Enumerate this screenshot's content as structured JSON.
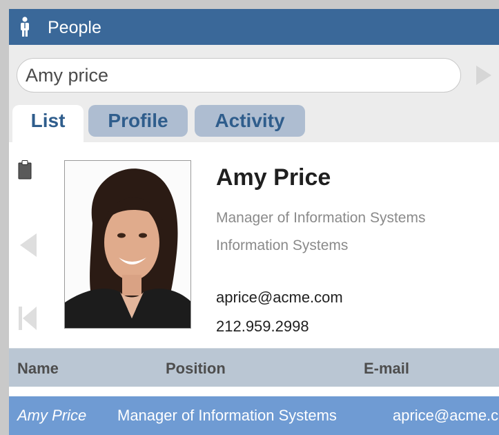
{
  "window": {
    "title": "People",
    "icon": "person-icon"
  },
  "search": {
    "value": "Amy price",
    "placeholder": "",
    "go_icon": "play-arrow-icon"
  },
  "tabs": [
    {
      "label": "List",
      "active": true
    },
    {
      "label": "Profile",
      "active": false
    },
    {
      "label": "Activity",
      "active": false
    }
  ],
  "profile": {
    "name": "Amy Price",
    "position": "Manager of Information Systems",
    "department": "Information Systems",
    "email": "aprice@acme.com",
    "phone": "212.959.2998",
    "icons": [
      "clipboard-icon",
      "previous-icon",
      "first-record-icon"
    ]
  },
  "table": {
    "columns": [
      "Name",
      "Position",
      "E-mail"
    ],
    "rows": [
      {
        "name": "Amy Price",
        "position": "Manager of Information Systems",
        "email": "aprice@acme.com",
        "selected": true
      }
    ]
  },
  "colors": {
    "titlebar": "#3a6899",
    "tab_text": "#2f5d8c",
    "inactive_tab": "#aebdd1",
    "header_row": "#bac6d3",
    "selected_row": "#6f9bd3"
  }
}
